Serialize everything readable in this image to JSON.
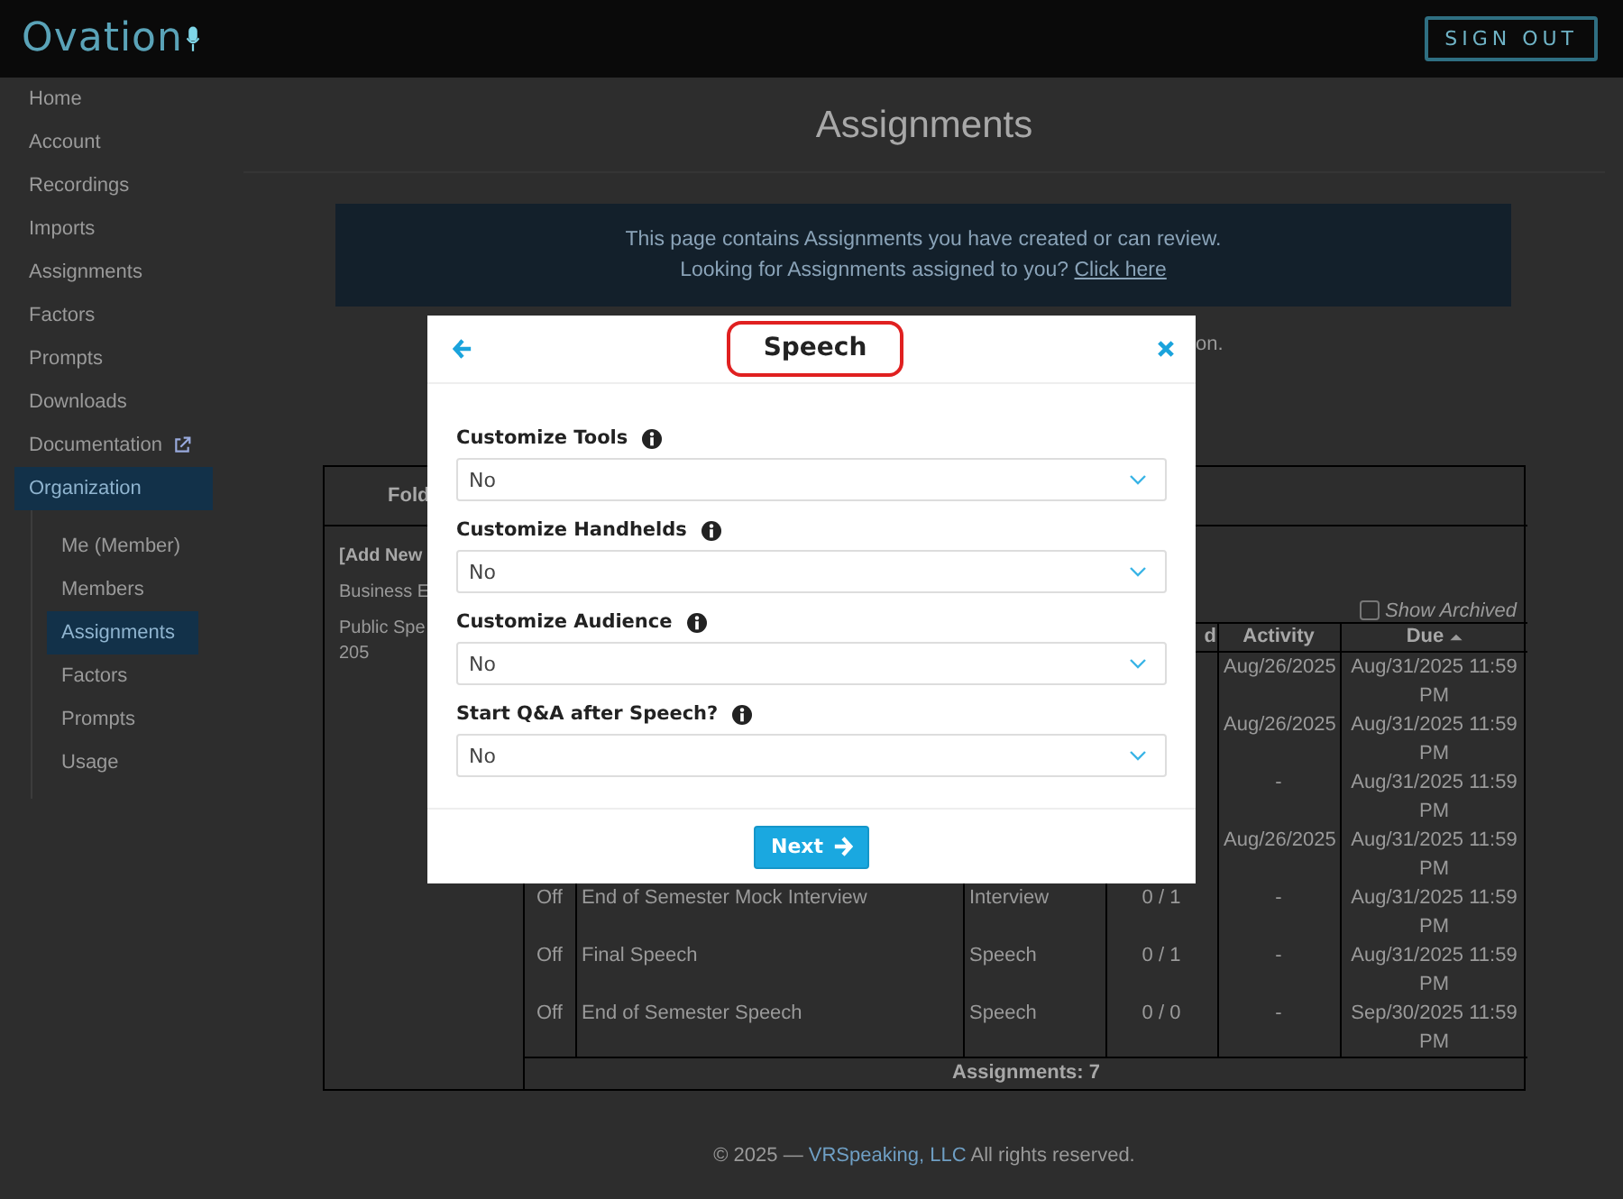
{
  "header": {
    "logo": "Ovation",
    "sign_out": "SIGN OUT"
  },
  "sidebar": {
    "items": [
      {
        "label": "Home",
        "selected": false,
        "external": false
      },
      {
        "label": "Account",
        "selected": false,
        "external": false
      },
      {
        "label": "Recordings",
        "selected": false,
        "external": false
      },
      {
        "label": "Imports",
        "selected": false,
        "external": false
      },
      {
        "label": "Assignments",
        "selected": false,
        "external": false
      },
      {
        "label": "Factors",
        "selected": false,
        "external": false
      },
      {
        "label": "Prompts",
        "selected": false,
        "external": false
      },
      {
        "label": "Downloads",
        "selected": false,
        "external": false
      },
      {
        "label": "Documentation",
        "selected": false,
        "external": true
      },
      {
        "label": "Organization",
        "selected": true,
        "external": false,
        "children": [
          {
            "label": "Me (Member)",
            "selected": false
          },
          {
            "label": "Members",
            "selected": false
          },
          {
            "label": "Assignments",
            "selected": true
          },
          {
            "label": "Factors",
            "selected": false
          },
          {
            "label": "Prompts",
            "selected": false
          },
          {
            "label": "Usage",
            "selected": false
          }
        ]
      }
    ]
  },
  "page": {
    "title": "Assignments",
    "notice": {
      "line_1": "This page contains Assignments you have created or can review.",
      "line_2": "Looking for Assignments assigned to you?",
      "link": "Click here"
    },
    "note_visible_part": "on.",
    "folders": {
      "header": "Fold",
      "items": [
        {
          "kind": "add",
          "lines": [
            "[Add New"
          ]
        },
        {
          "kind": "folder",
          "lines": [
            "Business E"
          ]
        },
        {
          "kind": "folder",
          "lines": [
            "Public Spe",
            "205"
          ]
        }
      ]
    },
    "show_archived": {
      "label": "Show Archived",
      "checked": false
    },
    "table": {
      "columns": [
        {
          "label": "d",
          "sorted_ascending": false
        },
        {
          "label": "Activity",
          "sorted_ascending": false
        },
        {
          "label": "Due",
          "sorted_ascending": true
        }
      ],
      "rows": [
        {
          "activity": "Aug/26/2025",
          "due": "Aug/31/2025 11:59 PM"
        },
        {
          "activity": "Aug/26/2025",
          "due": "Aug/31/2025 11:59 PM"
        },
        {
          "activity": "-",
          "due": "Aug/31/2025 11:59 PM"
        },
        {
          "activity": "Aug/26/2025",
          "due": "Aug/31/2025 11:59 PM"
        },
        {
          "status": "Off",
          "name": "End of Semester Mock Interview",
          "type": "Interview",
          "progress": "0 / 1",
          "activity": "-",
          "due": "Aug/31/2025 11:59 PM"
        },
        {
          "status": "Off",
          "name": "Final Speech",
          "type": "Speech",
          "progress": "0 / 1",
          "activity": "-",
          "due": "Aug/31/2025 11:59 PM"
        },
        {
          "status": "Off",
          "name": "End of Semester Speech",
          "type": "Speech",
          "progress": "0 / 0",
          "activity": "-",
          "due": "Sep/30/2025 11:59 PM"
        }
      ],
      "footer": "Assignments: 7"
    },
    "copyright": {
      "before": "© 2025 — ",
      "link": "VRSpeaking, LLC",
      "after": " All rights reserved."
    }
  },
  "modal": {
    "title": "Speech",
    "title_highlighted": true,
    "fields": [
      {
        "label": "Customize Tools",
        "value": "No"
      },
      {
        "label": "Customize Handhelds",
        "value": "No"
      },
      {
        "label": "Customize Audience",
        "value": "No"
      },
      {
        "label": "Start Q&A after Speech?",
        "value": "No"
      }
    ],
    "next": "Next"
  }
}
